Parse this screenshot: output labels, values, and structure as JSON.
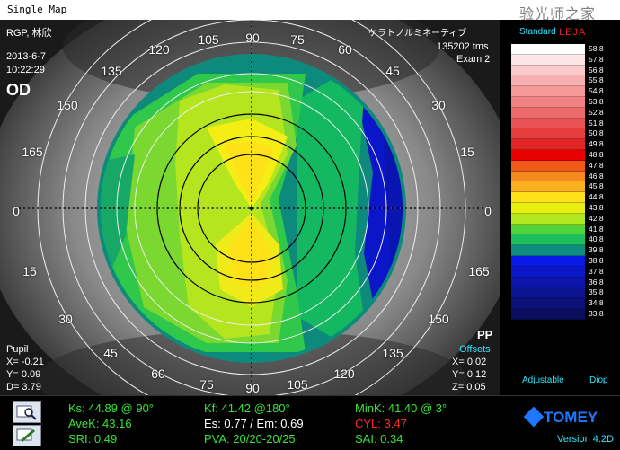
{
  "window": {
    "title": "Single Map",
    "watermark": "验光师之家"
  },
  "map": {
    "patient": "RGP, 林欣",
    "date": "2013-6-7",
    "time": "10:22:29",
    "eye": "OD",
    "right_info_1": "ケラトノルミネーティブ",
    "right_info_2": "135202 tms",
    "right_info_3": "Exam 2",
    "pupil": {
      "label": "Pupil",
      "x": "X= -0.21",
      "y": "Y=  0.09",
      "d": "D=  3.79"
    },
    "offsets": {
      "pp": "PP",
      "label": "Offsets",
      "x": "X=  0.02",
      "y": "Y=  0.12",
      "z": "Z=  0.05"
    },
    "degrees": [
      "0",
      "15",
      "30",
      "45",
      "60",
      "75",
      "90",
      "105",
      "120",
      "135",
      "150",
      "165",
      "0",
      "165",
      "150",
      "135",
      "120",
      "105",
      "90",
      "75",
      "60",
      "45",
      "30",
      "15"
    ]
  },
  "scale": {
    "title": "Standard",
    "watermark": "LEJA",
    "adjustable": "Adjustable",
    "diop": "Diop",
    "levels": [
      {
        "v": "58.8",
        "c": "#ffffff"
      },
      {
        "v": "57.8",
        "c": "#fde5e5"
      },
      {
        "v": "56.8",
        "c": "#fbcaca"
      },
      {
        "v": "55.8",
        "c": "#f9b0b0"
      },
      {
        "v": "54.8",
        "c": "#f69898"
      },
      {
        "v": "53.8",
        "c": "#f28282"
      },
      {
        "v": "52.8",
        "c": "#ee6b6b"
      },
      {
        "v": "51.8",
        "c": "#ea5353"
      },
      {
        "v": "50.8",
        "c": "#e53c3c"
      },
      {
        "v": "49.8",
        "c": "#e32424"
      },
      {
        "v": "48.8",
        "c": "#e80000"
      },
      {
        "v": "47.8",
        "c": "#f05a18"
      },
      {
        "v": "46.8",
        "c": "#f78a1f"
      },
      {
        "v": "45.8",
        "c": "#fbb020"
      },
      {
        "v": "44.8",
        "c": "#ffe119"
      },
      {
        "v": "43.8",
        "c": "#e7ef10"
      },
      {
        "v": "42.8",
        "c": "#b0e81f"
      },
      {
        "v": "41.8",
        "c": "#51d43a"
      },
      {
        "v": "40.8",
        "c": "#1bbf5e"
      },
      {
        "v": "39.8",
        "c": "#0e8c82"
      },
      {
        "v": "38.8",
        "c": "#0a1ae6"
      },
      {
        "v": "37.8",
        "c": "#0b18c8"
      },
      {
        "v": "36.8",
        "c": "#0c16ad"
      },
      {
        "v": "35.8",
        "c": "#0c1492"
      },
      {
        "v": "34.8",
        "c": "#0b1178"
      },
      {
        "v": "33.8",
        "c": "#0a0e5c"
      }
    ]
  },
  "measurements": {
    "ks": "Ks: 44.89 @ 90°",
    "kf": "Kf: 41.42 @180°",
    "mink": "MinK: 41.40 @  3°",
    "avek": "AveK: 43.16",
    "es": "Es: 0.77 / Em: 0.69",
    "cyl": "CYL:  3.47",
    "sri": "SRI: 0.49",
    "pva": "PVA: 20/20-20/25",
    "sai": "SAI: 0.34"
  },
  "brand": {
    "name": "TOMEY",
    "version": "Version 4.2D"
  }
}
